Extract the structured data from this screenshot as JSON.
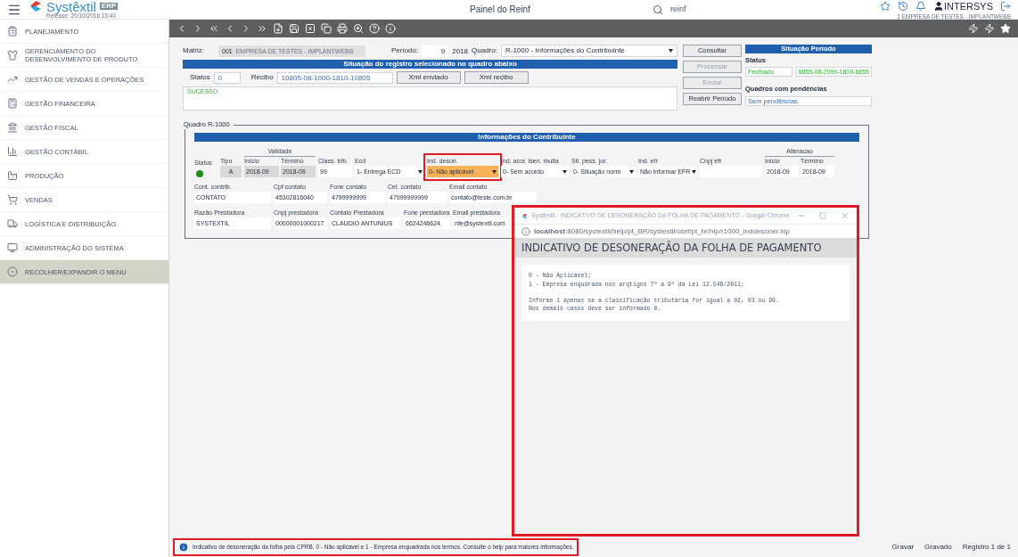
{
  "header": {
    "logo": "Systêxtil",
    "badge": "ERP",
    "release": "Release: 20/10/2016 15:40",
    "title": "Painel do Reinf",
    "search": "reinf",
    "user": "INTERSYS",
    "company": "1 EMPRESA DE TESTES - IMPLANTWEBB"
  },
  "sidebar": {
    "items": [
      {
        "label": "PLANEJAMENTO",
        "kind": "module"
      },
      {
        "label": "GERENCIAMENTO DO DESENVOLVIMENTO DE PRODUTO",
        "kind": "module"
      },
      {
        "label": "GESTÃO DE VENDAS E OPERAÇÕES",
        "kind": "module"
      },
      {
        "label": "GESTÃO FINANCEIRA",
        "kind": "module"
      },
      {
        "label": "GESTÃO FISCAL",
        "kind": "module"
      },
      {
        "label": "GESTÃO CONTÁBIL",
        "kind": "module"
      },
      {
        "label": "PRODUÇÃO",
        "kind": "module"
      },
      {
        "label": "VENDAS",
        "kind": "module"
      },
      {
        "label": "LOGÍSTICA E DISTRIBUIÇÃO",
        "kind": "module"
      },
      {
        "label": "ADMINISTRAÇÃO DO SISTEMA",
        "kind": "module"
      },
      {
        "label": "RECOLHER/EXPANDIR O MENU",
        "kind": "toggle"
      }
    ]
  },
  "form": {
    "matriz": {
      "label": "Matriz:",
      "code": "001",
      "name": "EMPRESA DE TESTES - IMPLANTWEBB"
    },
    "periodo": {
      "label": "Período:",
      "month": "9",
      "year": "2018"
    },
    "quadro": {
      "label": "Quadro:",
      "value": "R-1000 - Informações do Contribuinte"
    },
    "situacao_title": "Situação do registro selecionado no quadro abaixo",
    "status": {
      "label": "Status",
      "value": "0"
    },
    "recibo": {
      "label": "Recibo",
      "value": "10805-08-1000-1810-10805"
    },
    "xml_buttons": [
      "Xml enviado",
      "Xml recibo"
    ],
    "message": "SUCESSO",
    "actions": [
      {
        "label": "Consultar",
        "disabled": false
      },
      {
        "label": "Processar",
        "disabled": true
      },
      {
        "label": "Enviar",
        "disabled": true
      },
      {
        "label": "Reabrir Período",
        "disabled": false
      }
    ],
    "periodo_panel": {
      "title": "Situação Período",
      "status_label": "Status",
      "status": "Fechado",
      "recibo": "6855-08-2099-1809-6855",
      "pend_label": "Quadros com pendências",
      "pend": "Sem pendências."
    }
  },
  "quadro": {
    "legend": "Quadro R-1000",
    "title": "Informações do Contribuinte",
    "lines": [
      {
        "fields": [
          {
            "kind": "status",
            "label": "Status",
            "color": "#1a8f1a"
          },
          {
            "kind": "text",
            "label": "Tipo",
            "value": "A",
            "readonly": true
          },
          {
            "kind": "group",
            "label": "Validade",
            "fields": [
              {
                "label": "Início",
                "value": "2018-09",
                "readonly": true
              },
              {
                "label": "Término",
                "value": "2018-09",
                "readonly": true
              }
            ]
          },
          {
            "kind": "text",
            "label": "Class. trib.",
            "value": "99",
            "readonly": false
          },
          {
            "kind": "select",
            "label": "Ecd",
            "value": "1- Entrega ECD",
            "highlighted": false
          },
          {
            "kind": "select",
            "label": "Ind. deson.",
            "value": "0- Não aplicável",
            "highlighted": true
          },
          {
            "kind": "select",
            "label": "Ind. acor. isen. multa",
            "value": "0- Sem acordo",
            "highlighted": false
          },
          {
            "kind": "select",
            "label": "Sit. pess. jur.",
            "value": "0- Situação norm",
            "highlighted": false
          },
          {
            "kind": "select",
            "label": "Ind. efr",
            "value": "Não informar EFR",
            "highlighted": false
          },
          {
            "kind": "text",
            "label": "Cnpj efr",
            "readonly": false
          },
          {
            "kind": "group",
            "label": "Alteracao",
            "fields": [
              {
                "label": "Início",
                "value": "2018-09",
                "readonly": false
              },
              {
                "label": "Término",
                "value": "2018-09",
                "readonly": false
              }
            ]
          }
        ]
      },
      {
        "fields": [
          {
            "kind": "text",
            "label": "Cont. contrib.",
            "value": "CONTATO",
            "readonly": false
          },
          {
            "kind": "text",
            "label": "Cpf contato",
            "value": "45302816040",
            "readonly": false
          },
          {
            "kind": "text",
            "label": "Fone contato",
            "value": "4799999999",
            "readonly": false
          },
          {
            "kind": "text",
            "label": "Cel. contato",
            "value": "47999999999",
            "readonly": false
          },
          {
            "kind": "text",
            "label": "Email contato",
            "value": "contato@teste.com.br",
            "readonly": false
          }
        ]
      },
      {
        "fields": [
          {
            "kind": "text",
            "label": "Razão Prestadora",
            "value": "SYSTEXTIL",
            "readonly": false
          },
          {
            "kind": "text",
            "label": "Cnpj prestadora",
            "value": "00000001000217",
            "readonly": false
          },
          {
            "kind": "text",
            "label": "Contato Prestadora",
            "value": "CLAUDIO ANTUNIUS",
            "readonly": false
          },
          {
            "kind": "text",
            "label": "Fone prestadora",
            "value": "6624246624",
            "readonly": false
          },
          {
            "kind": "text",
            "label": "Email prestadora",
            "value": "nfe@systextil.com",
            "readonly": false
          }
        ]
      }
    ]
  },
  "help_window": {
    "title": "Systêxtil - INDICATIVO DE DESONERAÇÃO DA FOLHA DE PAGAMENTO - Google Chrome",
    "url": "**localhost**:8080/systextil/help/pt_BR/systextil/obrf/pt_br/hlp/r1000_inddesoner.hlp",
    "heading": "INDICATIVO DE DESONERAÇÃO DA FOLHA DE PAGAMENTO",
    "paragraphs": [
      [
        "0 - Não Aplicável;",
        "1 - Empresa enqudrada nos arqtigos 7º a 9º da Lei 12.546/2011;"
      ],
      [
        "Informe 1 apenas se a classificação tributária for igual a 02, 03 ou 99.",
        "Nos demais casos deve ser informado 0."
      ]
    ]
  },
  "status_bar": {
    "hint": "Indicativo de desoneração da folha pela CPRB. 0 - Não aplicável e 1 - Empresa enquadrada nos termos. Consulte o help para maiores informações.",
    "items": [
      "Gravar",
      "Gravado",
      "Registro 1 de 1"
    ]
  }
}
